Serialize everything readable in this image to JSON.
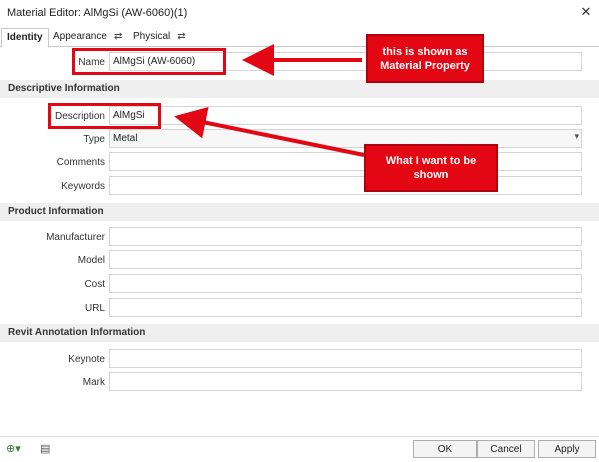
{
  "window": {
    "title": "Material Editor: AlMgSi (AW-6060)(1)",
    "close_glyph": "✕"
  },
  "tabs": [
    {
      "label": "Identity",
      "active": true
    },
    {
      "label": "Appearance",
      "active": false,
      "icon": "swap-icon"
    },
    {
      "label": "Physical",
      "active": false,
      "icon": "swap-icon"
    }
  ],
  "name_row": {
    "label": "Name",
    "value": "AlMgSi (AW-6060)"
  },
  "sections": {
    "descriptive": "Descriptive Information",
    "product": "Product Information",
    "revit": "Revit Annotation Information"
  },
  "descriptive_fields": {
    "description": {
      "label": "Description",
      "value": "AlMgSi"
    },
    "type": {
      "label": "Type",
      "value": "Metal"
    },
    "comments": {
      "label": "Comments",
      "value": ""
    },
    "keywords": {
      "label": "Keywords",
      "value": ""
    }
  },
  "product_fields": {
    "manufacturer": {
      "label": "Manufacturer",
      "value": ""
    },
    "model": {
      "label": "Model",
      "value": ""
    },
    "cost": {
      "label": "Cost",
      "value": ""
    },
    "url": {
      "label": "URL",
      "value": ""
    }
  },
  "revit_fields": {
    "keynote": {
      "label": "Keynote",
      "value": ""
    },
    "mark": {
      "label": "Mark",
      "value": ""
    }
  },
  "annotations": {
    "callout_top_line1": "this is shown as",
    "callout_top_line2": "Material Property",
    "callout_mid_line1": "What I want to be",
    "callout_mid_line2": "shown"
  },
  "footer": {
    "ok": "OK",
    "cancel": "Cancel",
    "apply": "Apply"
  },
  "colors": {
    "annotation_red": "#e30613",
    "section_bg": "#efefef"
  }
}
